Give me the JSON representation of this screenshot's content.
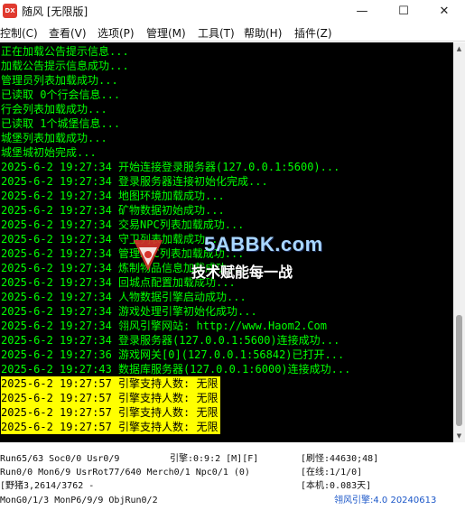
{
  "window": {
    "title": "随风 [无限版]",
    "icon_text": "DX",
    "icon_name": "app-logo-icon",
    "controls": {
      "minimize": "—",
      "maximize": "☐",
      "close": "✕"
    }
  },
  "menu": [
    "控制(C)",
    "查看(V)",
    "选项(P)",
    "管理(M)",
    "工具(T)",
    "帮助(H)",
    "插件(Z)"
  ],
  "console": {
    "lines": [
      "正在加载公告提示信息...",
      "加载公告提示信息成功...",
      "管理员列表加载成功...",
      "已读取 0个行会信息...",
      "行会列表加载成功...",
      "已读取 1个城堡信息...",
      "城堡列表加载成功...",
      "城堡城初始完成...",
      "2025-6-2 19:27:34 开始连接登录服务器(127.0.0.1:5600)...",
      "2025-6-2 19:27:34 登录服务器连接初始化完成...",
      "2025-6-2 19:27:34 地图环境加载成功...",
      "2025-6-2 19:27:34 矿物数据初始成功...",
      "2025-6-2 19:27:34 交易NPC列表加载成功...",
      "2025-6-2 19:27:34 守卫列表加载成功...",
      "2025-6-2 19:27:34 管理NPC列表加载成功...",
      "2025-6-2 19:27:34 炼制物品信息加载成功...",
      "2025-6-2 19:27:34 回城点配置加载成功...",
      "2025-6-2 19:27:34 人物数据引擎启动成功...",
      "2025-6-2 19:27:34 游戏处理引擎初始化成功...",
      "2025-6-2 19:27:34 翎风引擎网站: http://www.Haom2.Com",
      "2025-6-2 19:27:34 登录服务器(127.0.0.1:5600)连接成功...",
      "2025-6-2 19:27:36 游戏网关[0](127.0.0.1:56842)已打开...",
      "2025-6-2 19:27:43 数据库服务器(127.0.0.1:6000)连接成功...",
      "2025-6-2 19:27:57 引擎支持人数: 无限",
      "2025-6-2 19:27:57 引擎支持人数: 无限",
      "2025-6-2 19:27:57 引擎支持人数: 无限",
      "2025-6-2 19:27:57 引擎支持人数: 无限"
    ],
    "highlighted_from": 23,
    "colors": {
      "background": "#000000",
      "text": "#00ff00",
      "highlight_bg": "#ffff00",
      "highlight_text": "#000000"
    }
  },
  "scrollbar": {
    "up": "▲",
    "down": "▼",
    "position": 0.71
  },
  "watermark": {
    "url": "5ABBK.com",
    "slogan": "技术赋能每一战"
  },
  "status": {
    "r1_a": "Run65/63 Soc0/0 Usr0/9",
    "r1_b": "引擎:0:9:2 [M][F]",
    "r1_c": "[刷怪:44630;48]",
    "r2_a": "Run0/0 Mon6/9 UsrRot77/640 Merch0/1 Npc0/1 (0)",
    "r2_c": "[在线:1/1/0]",
    "r3_a": "[野猪3,2614/3762 -",
    "r3_c": "[本机:0.083天]",
    "r4_a": "MonG0/1/3 MonP6/9/9 ObjRun0/2",
    "r4_c": "翎风引擎:4.0 20240613"
  }
}
